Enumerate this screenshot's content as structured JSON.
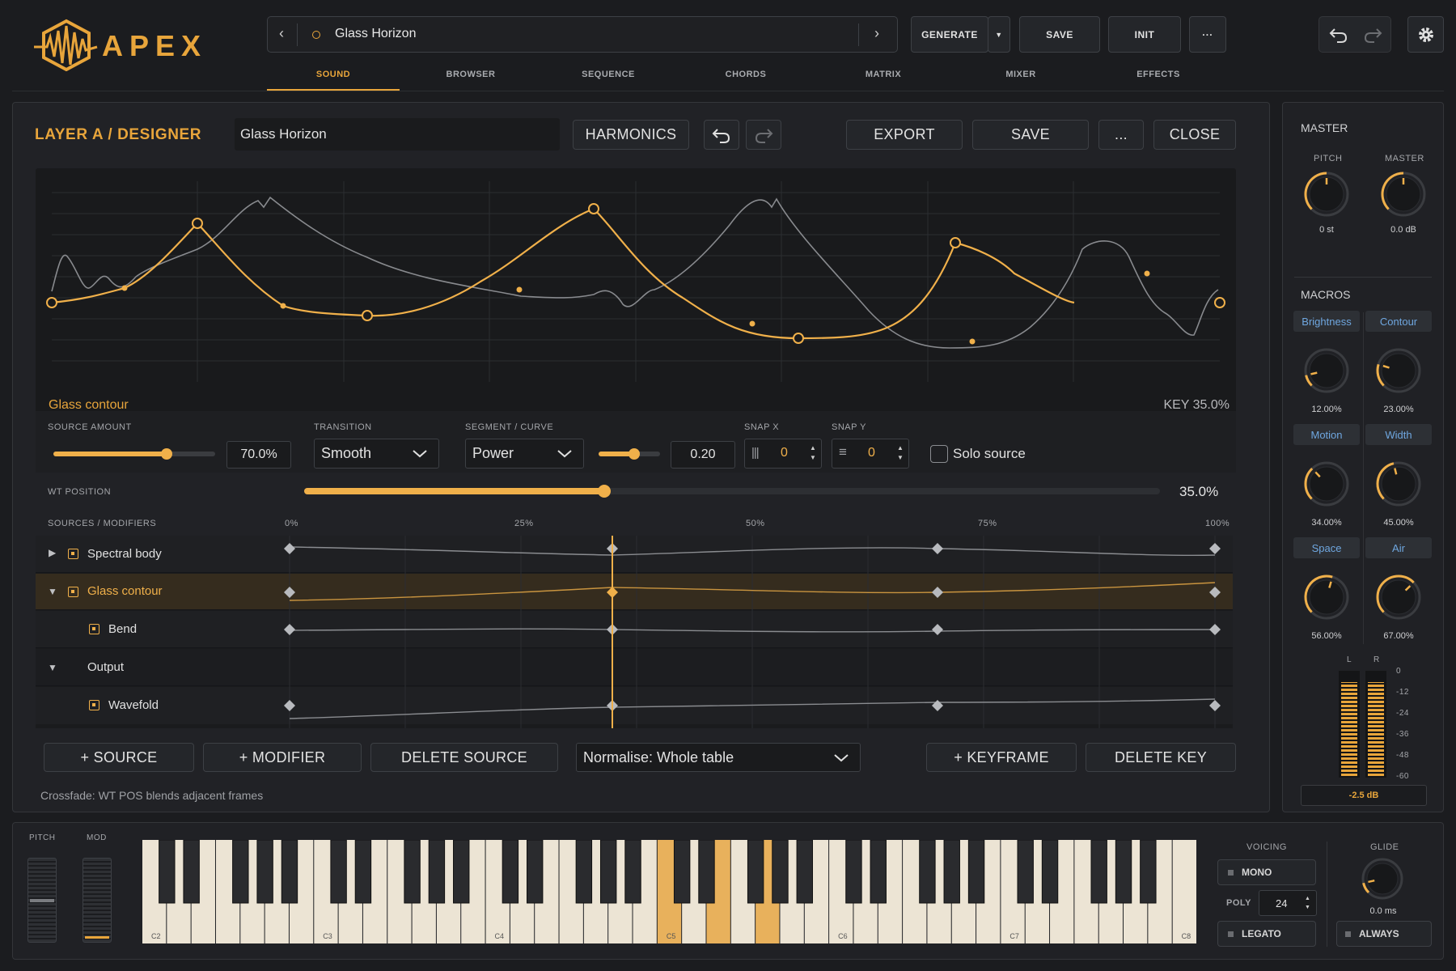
{
  "app": {
    "logo_text": "APEX"
  },
  "preset_bar": {
    "name": "Glass Horizon"
  },
  "top_buttons": {
    "generate": "GENERATE",
    "save": "SAVE",
    "init": "INIT",
    "more": "···"
  },
  "tabs": [
    {
      "label": "SOUND",
      "active": true
    },
    {
      "label": "BROWSER"
    },
    {
      "label": "SEQUENCE"
    },
    {
      "label": "CHORDS"
    },
    {
      "label": "MATRIX"
    },
    {
      "label": "MIXER"
    },
    {
      "label": "EFFECTS"
    }
  ],
  "designer": {
    "title": "LAYER A / DESIGNER",
    "name_value": "Glass Horizon",
    "harmonics": "HARMONICS",
    "export": "EXPORT",
    "save": "SAVE",
    "more": "...",
    "close": "CLOSE",
    "contour_name": "Glass contour",
    "key_readout": "KEY 35.0%",
    "source_amount_label": "SOURCE AMOUNT",
    "source_amount_value": "70.0%",
    "source_amount_level": 0.7,
    "transition_label": "TRANSITION",
    "transition_value": "Smooth",
    "segment_label": "SEGMENT / CURVE",
    "segment_value": "Power",
    "curve_value": "0.20",
    "snap_x_label": "SNAP X",
    "snap_x_value": "0",
    "snap_y_label": "SNAP Y",
    "snap_y_value": "0",
    "solo_label": "Solo source",
    "wt_label": "WT POSITION",
    "wt_value": "35.0%",
    "wt_level": 0.35,
    "sources_label": "SOURCES / MODIFIERS",
    "timeline_ticks": [
      "0%",
      "25%",
      "50%",
      "75%",
      "100%"
    ],
    "rows": [
      {
        "label": "Spectral body"
      },
      {
        "label": "Glass contour"
      },
      {
        "label": "Bend"
      },
      {
        "label": "Output"
      },
      {
        "label": "Wavefold"
      }
    ],
    "add_source": "+ SOURCE",
    "add_modifier": "+ MODIFIER",
    "delete_source": "DELETE SOURCE",
    "normalise": "Normalise: Whole table",
    "add_keyframe": "+ KEYFRAME",
    "delete_key": "DELETE KEY",
    "footer_note": "Crossfade: WT POS blends adjacent frames"
  },
  "master": {
    "title": "MASTER",
    "pitch_label": "PITCH",
    "pitch_value": "0 st",
    "master_label": "MASTER",
    "master_value": "0.0 dB",
    "macros_title": "MACROS",
    "macros": [
      {
        "name": "Brightness",
        "value": "12.00%",
        "level": 0.12
      },
      {
        "name": "Contour",
        "value": "23.00%",
        "level": 0.23
      },
      {
        "name": "Motion",
        "value": "34.00%",
        "level": 0.34
      },
      {
        "name": "Width",
        "value": "45.00%",
        "level": 0.45
      },
      {
        "name": "Space",
        "value": "56.00%",
        "level": 0.56
      },
      {
        "name": "Air",
        "value": "67.00%",
        "level": 0.67
      }
    ],
    "meter_l": "L",
    "meter_r": "R",
    "meter_scale": [
      "0",
      "-12",
      "-24",
      "-36",
      "-48",
      "-60"
    ],
    "meter_readout": "-2.5 dB"
  },
  "keyboard": {
    "pitch_label": "PITCH",
    "mod_label": "MOD",
    "octave_labels": [
      "C2",
      "C3",
      "C4",
      "C5",
      "C6",
      "C7",
      "C8"
    ],
    "voicing_label": "VOICING",
    "mono": "MONO",
    "poly_label": "POLY",
    "poly_value": "24",
    "legato": "LEGATO",
    "glide_label": "GLIDE",
    "glide_value": "0.0 ms",
    "always": "ALWAYS"
  },
  "colors": {
    "accent": "#f0b04a",
    "bg": "#1b1c1f",
    "panel": "#212226"
  }
}
